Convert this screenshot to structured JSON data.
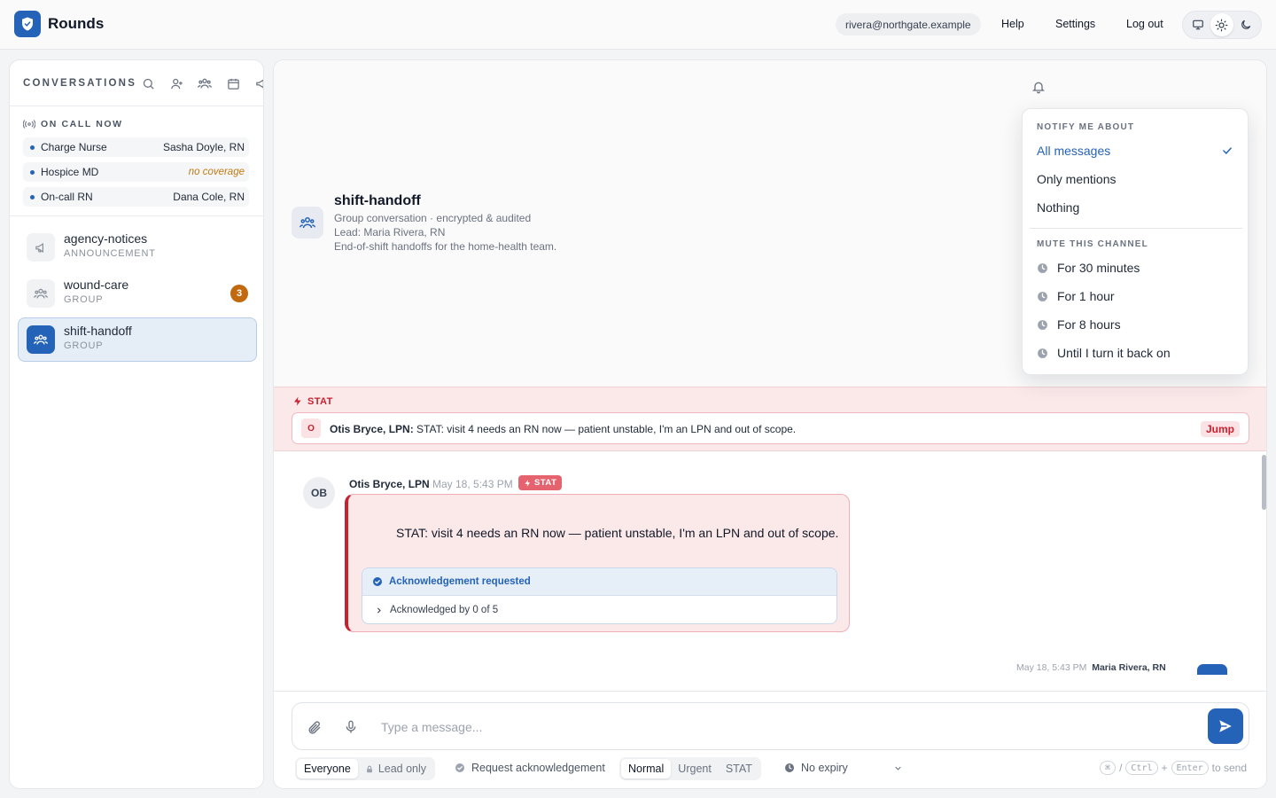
{
  "app": {
    "title": "Rounds"
  },
  "topbar": {
    "user_email": "rivera@northgate.example",
    "links": [
      "Help",
      "Settings",
      "Log out"
    ],
    "theme_options": [
      "monitor-icon",
      "sun-icon",
      "moon-icon"
    ],
    "theme_selected": "sun-icon"
  },
  "sidebar": {
    "title": "CONVERSATIONS",
    "toolbar_icons": [
      "search-icon",
      "add-person-icon",
      "group-icon",
      "calendar-icon",
      "megaphone-icon"
    ],
    "on_call": {
      "title": "ON CALL NOW",
      "rows": [
        {
          "role": "Charge Nurse",
          "name": "Sasha Doyle, RN",
          "coverage": true
        },
        {
          "role": "Hospice MD",
          "name": "no coverage",
          "coverage": false
        },
        {
          "role": "On-call RN",
          "name": "Dana Cole, RN",
          "coverage": true
        }
      ]
    },
    "channels": [
      {
        "name": "agency-notices",
        "type": "ANNOUNCEMENT",
        "icon": "megaphone-icon",
        "badge": ""
      },
      {
        "name": "wound-care",
        "type": "GROUP",
        "icon": "group-icon",
        "badge": "3"
      },
      {
        "name": "shift-handoff",
        "type": "GROUP",
        "icon": "group-icon",
        "badge": "",
        "active": true
      }
    ]
  },
  "channel": {
    "name": "shift-handoff",
    "subtitle": "Group conversation · encrypted & audited",
    "lead": "Lead: Maria Rivera, RN",
    "description": "End-of-shift handoffs for the home-health team."
  },
  "notify_menu": {
    "section_notify": "NOTIFY ME ABOUT",
    "notify_options": [
      "All messages",
      "Only mentions",
      "Nothing"
    ],
    "notify_selected": "All messages",
    "section_mute": "MUTE THIS CHANNEL",
    "mute_options": [
      "For 30 minutes",
      "For 1 hour",
      "For 8 hours",
      "Until I turn it back on"
    ]
  },
  "stat_banner": {
    "label": "STAT",
    "avatar": "O",
    "author": "Otis Bryce, LPN:",
    "text": "STAT: visit 4 needs an RN now — patient unstable, I'm an LPN and out of scope.",
    "jump_label": "Jump"
  },
  "messages": [
    {
      "initials": "OB",
      "author": "Otis Bryce, LPN",
      "time": "May 18, 5:43 PM",
      "priority": "STAT",
      "text": "STAT: visit 4 needs an RN now — patient unstable, I'm an LPN and out of scope.",
      "ack_title": "Acknowledgement requested",
      "ack_status": "Acknowledged by 0 of 5"
    }
  ],
  "next_message_peek": {
    "time": "May 18, 5:43 PM",
    "author": "Maria Rivera, RN"
  },
  "composer": {
    "placeholder": "Type a message...",
    "audience": [
      "Everyone",
      "Lead only"
    ],
    "audience_selected": "Everyone",
    "request_ack": "Request acknowledgement",
    "priority": [
      "Normal",
      "Urgent",
      "STAT"
    ],
    "priority_selected": "Normal",
    "expiry": "No expiry",
    "hint_keys": [
      "⌘",
      "Ctrl",
      "Enter"
    ],
    "hint_plus": "+",
    "hint_text": "to send"
  },
  "colors": {
    "accent": "#2563b8",
    "stat": "#c7202f",
    "badge": "#c2690f",
    "warning_text": "#c27a12"
  }
}
